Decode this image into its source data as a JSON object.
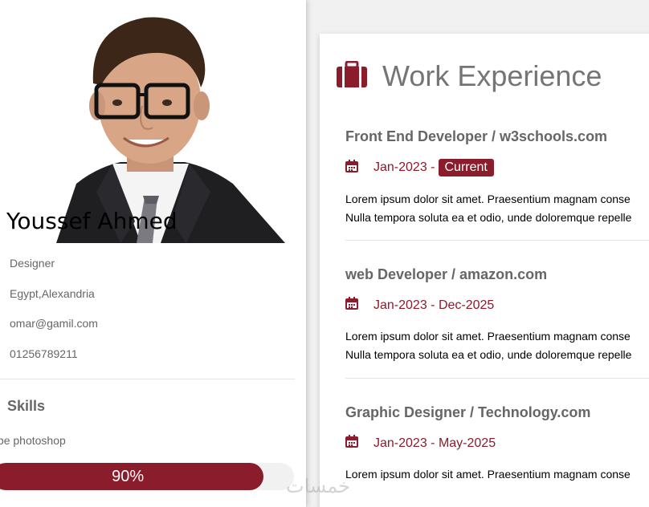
{
  "profile": {
    "name": "Youssef Ahmed",
    "job": "Designer",
    "location": "Egypt,Alexandria",
    "email": "omar@gamil.com",
    "phone": "01256789211"
  },
  "skills": {
    "title": "Skills",
    "items": [
      {
        "name": "Adobe photoshop",
        "percent_label": "90%",
        "level": 0.9
      }
    ]
  },
  "work": {
    "title": "Work Experience",
    "jobs": [
      {
        "title": "Front End Developer / w3schools.com",
        "date": "Jan-2023 -",
        "current_label": "Current",
        "desc1": "Lorem ipsum dolor sit amet. Praesentium magnam conse",
        "desc2": "Nulla tempora soluta ea et odio, unde doloremque repelle"
      },
      {
        "title": "web Developer / amazon.com",
        "date": "Jan-2023 - Dec-2025",
        "desc1": "Lorem ipsum dolor sit amet. Praesentium magnam conse",
        "desc2": "Nulla tempora soluta ea et odio, unde doloremque repelle"
      },
      {
        "title": "Graphic Designer / Technology.com",
        "date": "Jan-2023 - May-2025",
        "desc1": "Lorem ipsum dolor sit amet. Praesentium magnam conse"
      }
    ]
  },
  "watermark": "خمسات",
  "colors": {
    "accent": "#8a1c2b",
    "muted_text": "#666666"
  },
  "icons": [
    "briefcase-icon",
    "calendar-icon"
  ]
}
